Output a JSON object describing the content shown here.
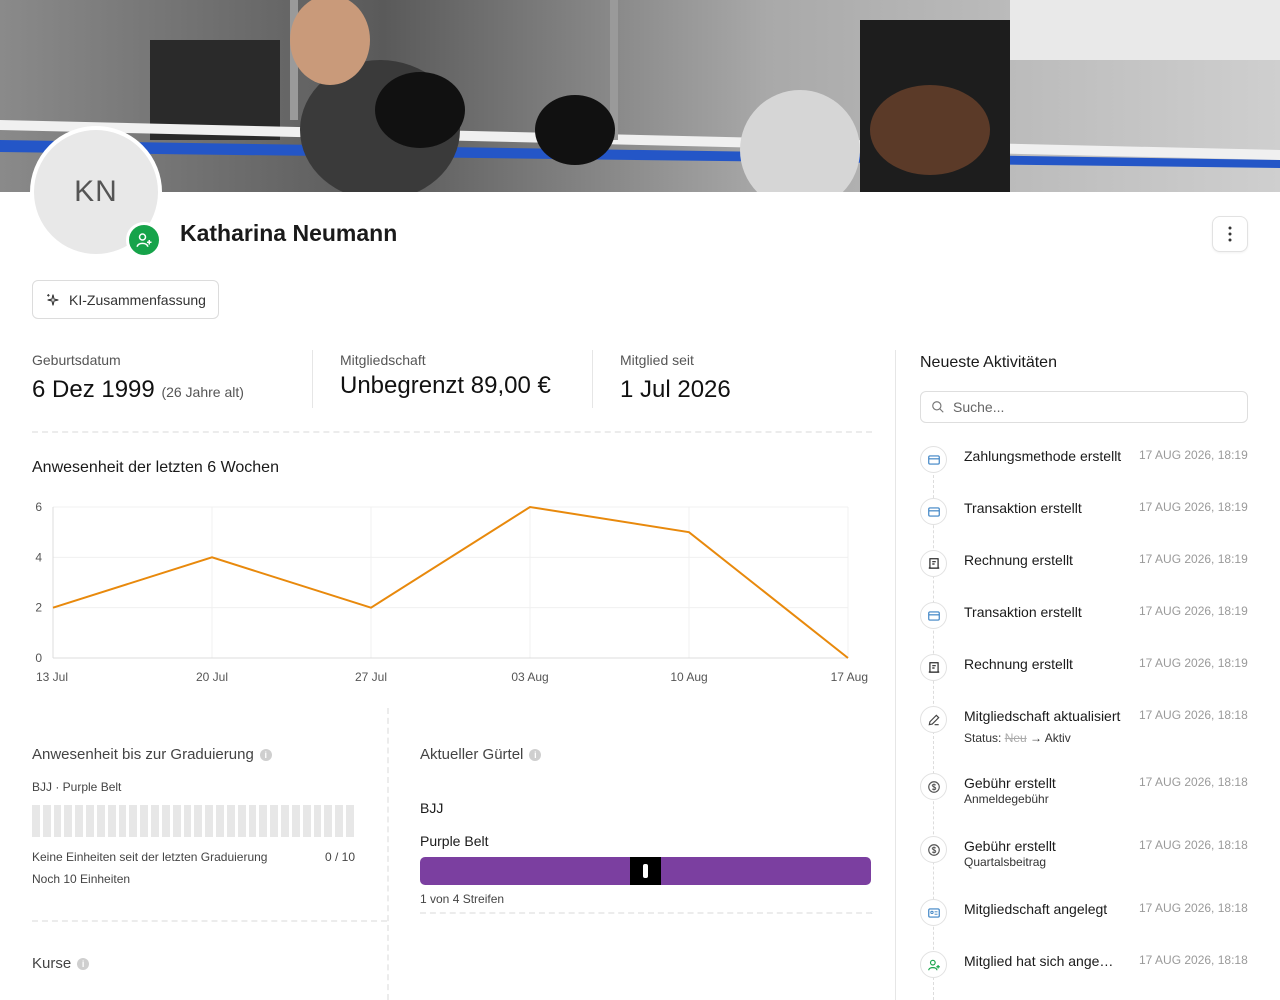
{
  "profile": {
    "initials": "KN",
    "name": "Katharina Neumann",
    "ai_summary_label": "KI-Zusammenfassung"
  },
  "stats": [
    {
      "label": "Geburtsdatum",
      "value": "6 Dez 1999",
      "note": "(26 Jahre alt)"
    },
    {
      "label": "Mitgliedschaft",
      "value": "Unbegrenzt 89,00 €",
      "note": ""
    },
    {
      "label": "Mitglied seit",
      "value": "1 Jul 2026",
      "note": ""
    }
  ],
  "attendance": {
    "title": "Anwesenheit der letzten 6 Wochen"
  },
  "chart_data": {
    "type": "line",
    "title": "Anwesenheit der letzten 6 Wochen",
    "categories": [
      "13 Jul",
      "20 Jul",
      "27 Jul",
      "03 Aug",
      "10 Aug",
      "17 Aug"
    ],
    "values": [
      2,
      4,
      2,
      6,
      5,
      0
    ],
    "yticks": [
      0,
      2,
      4,
      6
    ],
    "ylim": [
      0,
      6
    ],
    "grid": true,
    "line_color": "#e8890c"
  },
  "graduation": {
    "title": "Anwesenheit bis zur Graduierung",
    "program": "BJJ · Purple Belt",
    "note": "Keine Einheiten seit der letzten Graduierung",
    "count": "0 / 10",
    "progress": 0,
    "remaining": "Noch 10 Einheiten"
  },
  "belt": {
    "title": "Aktueller Gürtel",
    "program": "BJJ",
    "name": "Purple Belt",
    "stripes": "1 von 4 Streifen",
    "color": "#7b3fa0"
  },
  "courses": {
    "title": "Kurse"
  },
  "activities": {
    "title": "Neueste Aktivitäten",
    "search_placeholder": "Suche...",
    "items": [
      {
        "icon": "credit-card-icon",
        "title": "Zahlungsmethode erstellt",
        "date": "17 AUG 2026, 18:19",
        "sub": ""
      },
      {
        "icon": "credit-card-icon",
        "title": "Transaktion erstellt",
        "date": "17 AUG 2026, 18:19",
        "sub": ""
      },
      {
        "icon": "invoice-icon",
        "title": "Rechnung erstellt",
        "date": "17 AUG 2026, 18:19",
        "sub": ""
      },
      {
        "icon": "credit-card-icon",
        "title": "Transaktion erstellt",
        "date": "17 AUG 2026, 18:19",
        "sub": ""
      },
      {
        "icon": "invoice-icon",
        "title": "Rechnung erstellt",
        "date": "17 AUG 2026, 18:19",
        "sub": ""
      },
      {
        "icon": "pencil-icon",
        "title": "Mitgliedschaft aktualisiert",
        "date": "17 AUG 2026, 18:18",
        "sub": "",
        "status_label": "Status:",
        "status_old": "Neu",
        "status_new": "Aktiv"
      },
      {
        "icon": "dollar-icon",
        "title": "Gebühr erstellt",
        "date": "17 AUG 2026, 18:18",
        "sub": "Anmeldegebühr"
      },
      {
        "icon": "dollar-icon",
        "title": "Gebühr erstellt",
        "date": "17 AUG 2026, 18:18",
        "sub": "Quartalsbeitrag"
      },
      {
        "icon": "id-card-icon",
        "title": "Mitgliedschaft angelegt",
        "date": "17 AUG 2026, 18:18",
        "sub": ""
      },
      {
        "icon": "user-plus-icon",
        "title": "Mitglied hat sich angemeldet",
        "date": "17 AUG 2026, 18:18",
        "sub": ""
      }
    ]
  }
}
